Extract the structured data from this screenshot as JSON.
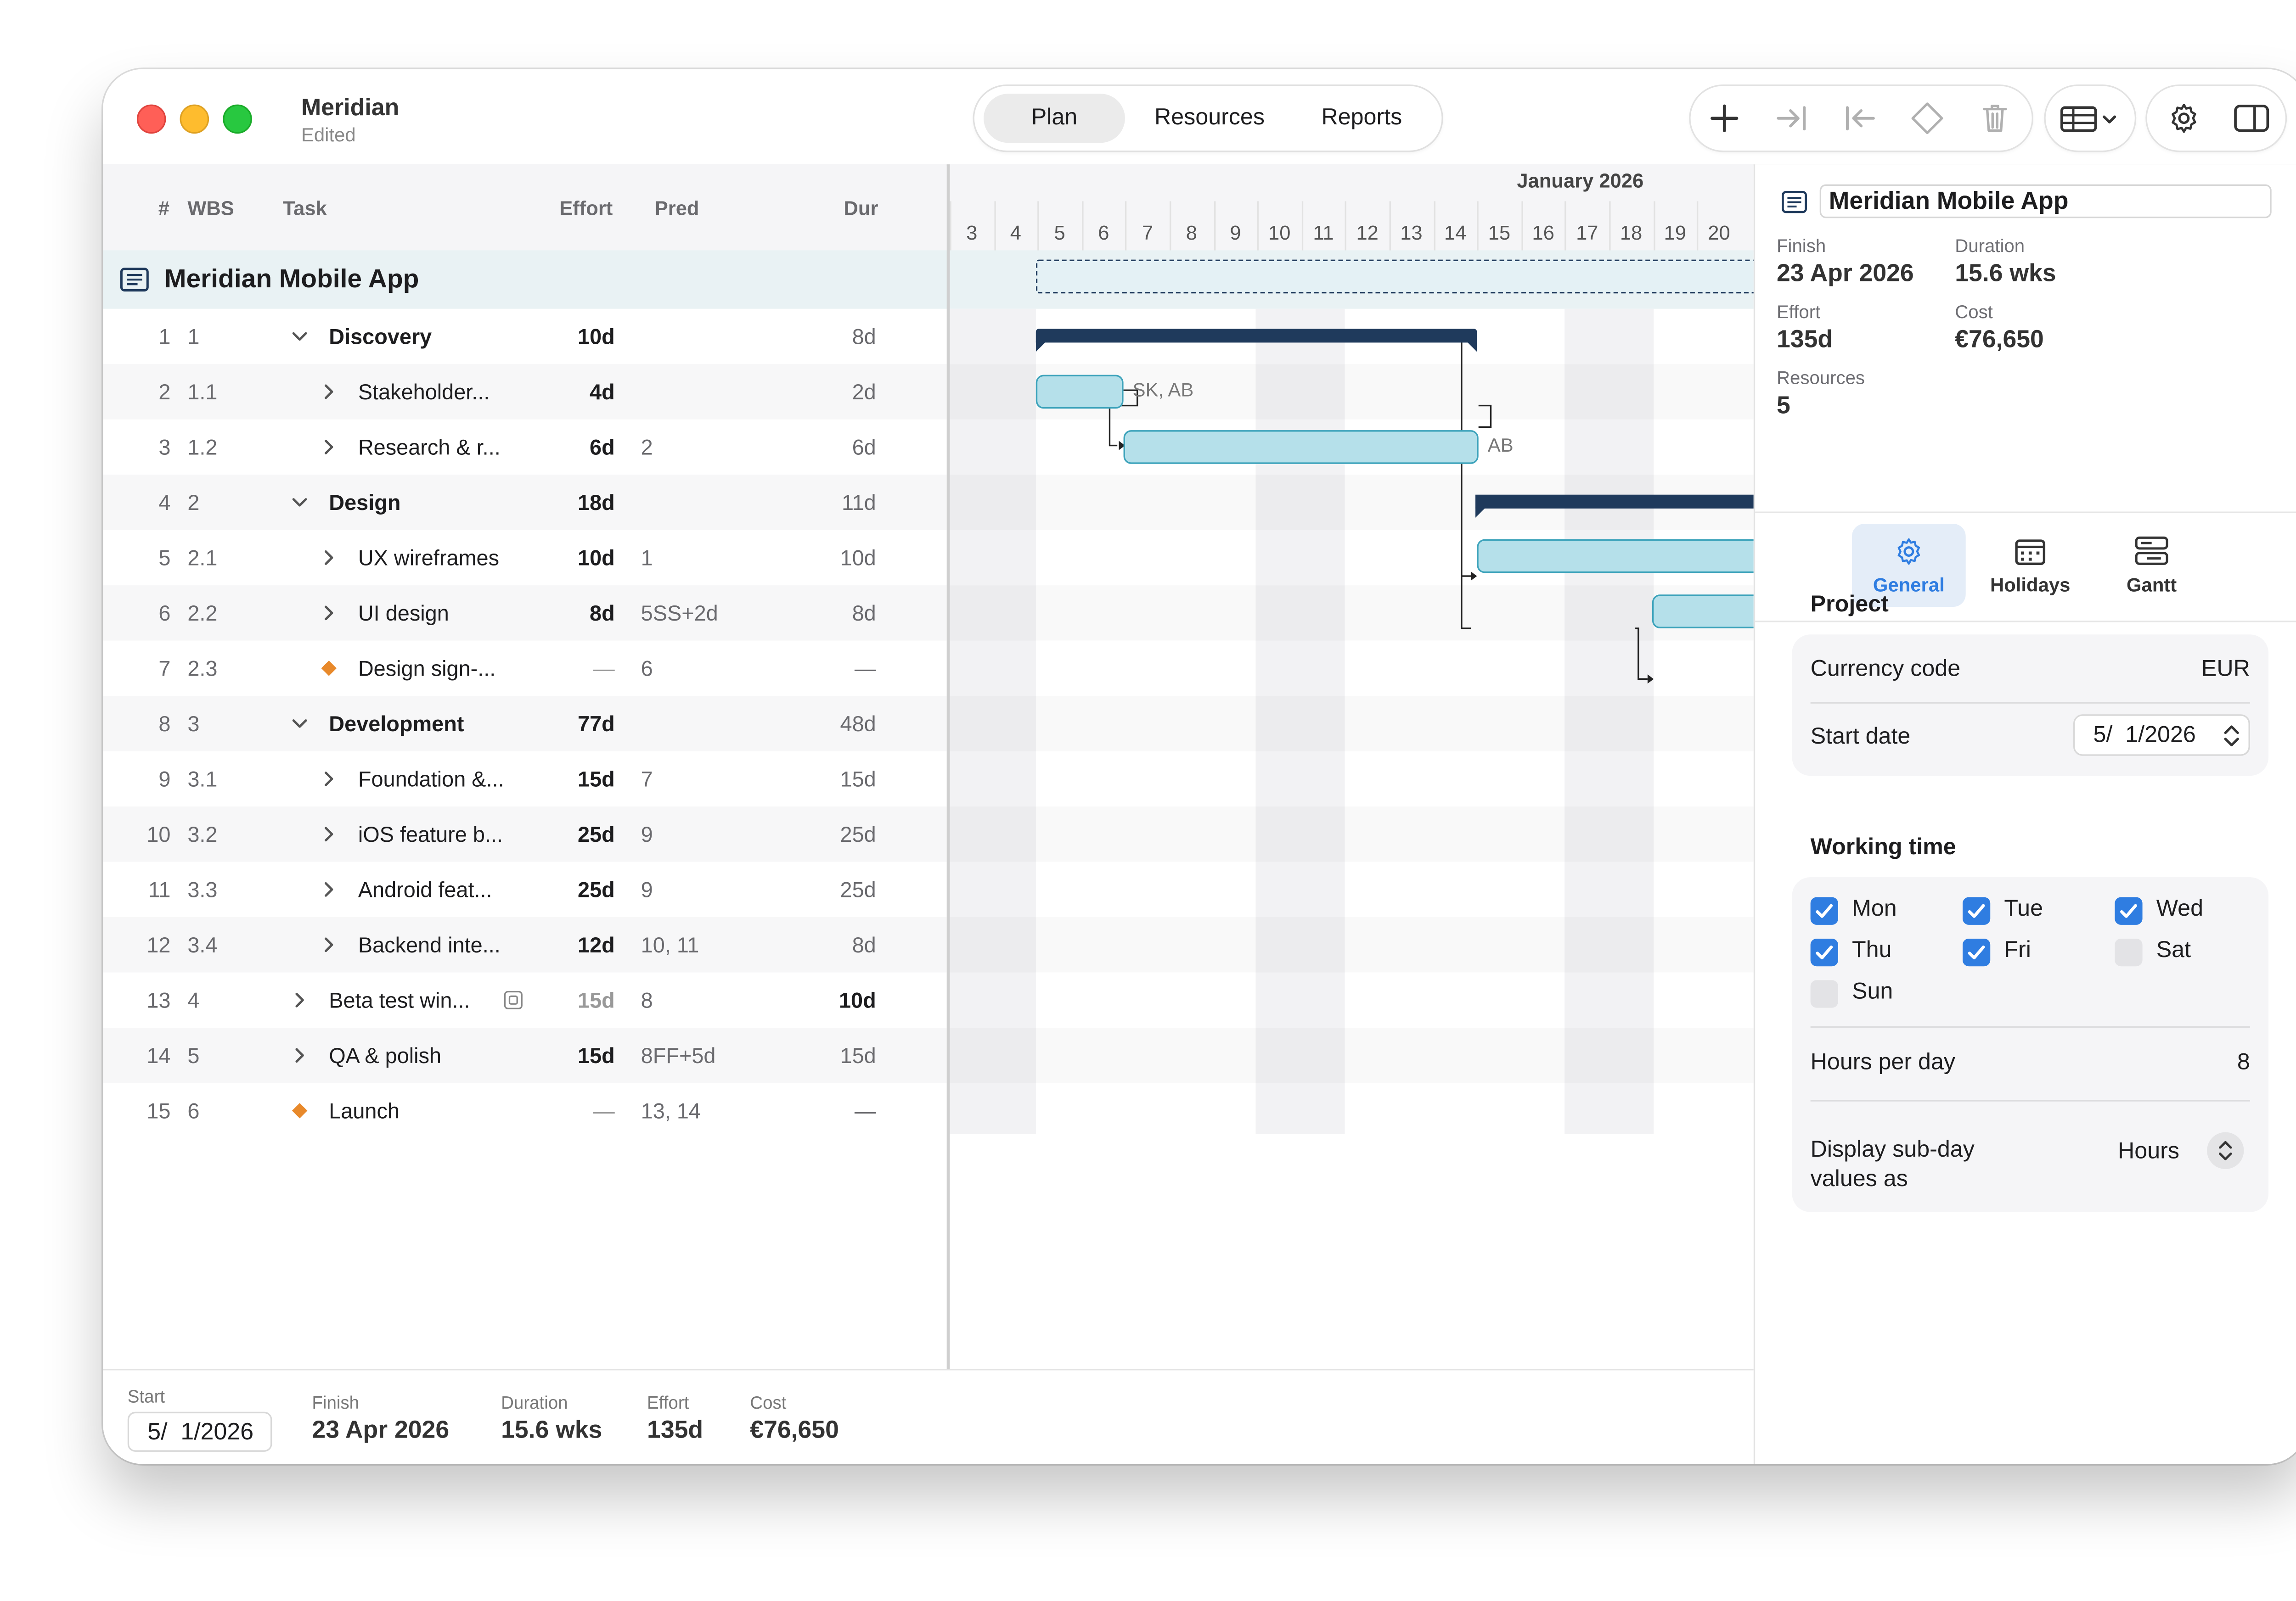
{
  "window": {
    "title": "Meridian",
    "subtitle": "Edited"
  },
  "segments": [
    "Plan",
    "Resources",
    "Reports"
  ],
  "active_segment": "Plan",
  "toolbar_icons": [
    "add-icon",
    "indent-icon",
    "outdent-icon",
    "milestone-icon",
    "trash-icon",
    "table-view-icon",
    "chevron-down-icon",
    "gear-icon",
    "sidebar-icon"
  ],
  "columns": {
    "num": "#",
    "wbs": "WBS",
    "task": "Task",
    "effort": "Effort",
    "pred": "Pred",
    "dur": "Dur"
  },
  "project_row": {
    "name": "Meridian Mobile App"
  },
  "tasks": [
    {
      "num": "1",
      "wbs": "1",
      "name": "Discovery",
      "effort": "10d",
      "pred": "",
      "dur": "8d",
      "bold": true,
      "level": 1,
      "expander": "down"
    },
    {
      "num": "2",
      "wbs": "1.1",
      "name": "Stakeholder...",
      "effort": "4d",
      "pred": "",
      "dur": "2d",
      "level": 2,
      "expander": "right"
    },
    {
      "num": "3",
      "wbs": "1.2",
      "name": "Research & r...",
      "effort": "6d",
      "pred": "2",
      "dur": "6d",
      "level": 2,
      "expander": "right"
    },
    {
      "num": "4",
      "wbs": "2",
      "name": "Design",
      "effort": "18d",
      "pred": "",
      "dur": "11d",
      "bold": true,
      "level": 1,
      "expander": "down"
    },
    {
      "num": "5",
      "wbs": "2.1",
      "name": "UX wireframes",
      "effort": "10d",
      "pred": "1",
      "dur": "10d",
      "level": 2,
      "expander": "right"
    },
    {
      "num": "6",
      "wbs": "2.2",
      "name": "UI design",
      "effort": "8d",
      "pred": "5SS+2d",
      "dur": "8d",
      "level": 2,
      "expander": "right"
    },
    {
      "num": "7",
      "wbs": "2.3",
      "name": "Design sign-...",
      "effort": "—",
      "pred": "6",
      "dur": "—",
      "level": 2,
      "expander": "diamond"
    },
    {
      "num": "8",
      "wbs": "3",
      "name": "Development",
      "effort": "77d",
      "pred": "",
      "dur": "48d",
      "bold": true,
      "level": 1,
      "expander": "down"
    },
    {
      "num": "9",
      "wbs": "3.1",
      "name": "Foundation &...",
      "effort": "15d",
      "pred": "7",
      "dur": "15d",
      "level": 2,
      "expander": "right"
    },
    {
      "num": "10",
      "wbs": "3.2",
      "name": "iOS feature b...",
      "effort": "25d",
      "pred": "9",
      "dur": "25d",
      "level": 2,
      "expander": "right"
    },
    {
      "num": "11",
      "wbs": "3.3",
      "name": "Android feat...",
      "effort": "25d",
      "pred": "9",
      "dur": "25d",
      "level": 2,
      "expander": "right"
    },
    {
      "num": "12",
      "wbs": "3.4",
      "name": "Backend inte...",
      "effort": "12d",
      "pred": "10, 11",
      "dur": "8d",
      "level": 2,
      "expander": "right"
    },
    {
      "num": "13",
      "wbs": "4",
      "name": "Beta test win...",
      "effort": "15d",
      "pred": "8",
      "dur": "10d",
      "level": 1,
      "expander": "right",
      "note_icon": true
    },
    {
      "num": "14",
      "wbs": "5",
      "name": "QA & polish",
      "effort": "15d",
      "pred": "8FF+5d",
      "dur": "15d",
      "level": 1,
      "expander": "right"
    },
    {
      "num": "15",
      "wbs": "6",
      "name": "Launch",
      "effort": "—",
      "pred": "13, 14",
      "dur": "—",
      "level": 1,
      "expander": "diamond"
    }
  ],
  "gantt": {
    "month": "January 2026",
    "days": [
      "3",
      "4",
      "5",
      "6",
      "7",
      "8",
      "9",
      "10",
      "11",
      "12",
      "13",
      "14",
      "15",
      "16",
      "17",
      "18",
      "19",
      "20"
    ],
    "resource_labels": {
      "stakeholder": "SK, AB",
      "research": "AB"
    }
  },
  "footer": {
    "start_label": "Start",
    "start_value": "5/  1/2026",
    "finish_label": "Finish",
    "finish_value": "23 Apr 2026",
    "duration_label": "Duration",
    "duration_value": "15.6 wks",
    "effort_label": "Effort",
    "effort_value": "135d",
    "cost_label": "Cost",
    "cost_value": "€76,650"
  },
  "inspector": {
    "name": "Meridian Mobile App",
    "finish_label": "Finish",
    "finish_value": "23 Apr 2026",
    "duration_label": "Duration",
    "duration_value": "15.6 wks",
    "effort_label": "Effort",
    "effort_value": "135d",
    "cost_label": "Cost",
    "cost_value": "€76,650",
    "resources_label": "Resources",
    "resources_value": "5",
    "tabs": [
      "General",
      "Holidays",
      "Gantt"
    ],
    "active_tab": "General",
    "project_title": "Project",
    "currency_label": "Currency code",
    "currency_value": "EUR",
    "start_label": "Start date",
    "start_value": "5/  1/2026",
    "working_title": "Working time",
    "days": [
      {
        "label": "Mon",
        "checked": true
      },
      {
        "label": "Tue",
        "checked": true
      },
      {
        "label": "Wed",
        "checked": true
      },
      {
        "label": "Thu",
        "checked": true
      },
      {
        "label": "Fri",
        "checked": true
      },
      {
        "label": "Sat",
        "checked": false
      },
      {
        "label": "Sun",
        "checked": false
      }
    ],
    "hours_label": "Hours per day",
    "hours_value": "8",
    "subday_label_1": "Display sub-day",
    "subday_label_2": "values as",
    "subday_value": "Hours"
  },
  "colors": {
    "accent": "#2f7de1",
    "bar_fill": "#b5e0ea",
    "bar_border": "#3da3bb",
    "summary_bar": "#1f3a5c",
    "milestone": "#e8892b",
    "project_row": "#e9f2f4"
  }
}
